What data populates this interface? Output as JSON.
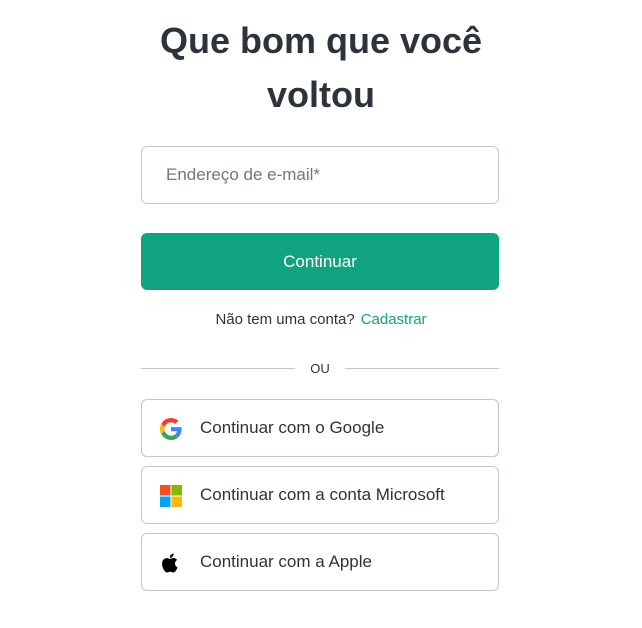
{
  "login": {
    "title_line1": "Que bom que você",
    "title_line2": "voltou",
    "email_placeholder": "Endereço de e-mail*",
    "email_value": "",
    "continue_label": "Continuar",
    "signup_prompt": "Não tem uma conta?",
    "signup_link": "Cadastrar",
    "divider_text": "OU",
    "providers": [
      {
        "label": "Continuar com o Google",
        "icon": "google-icon"
      },
      {
        "label": "Continuar com a conta Microsoft",
        "icon": "microsoft-icon"
      },
      {
        "label": "Continuar com a Apple",
        "icon": "apple-icon"
      }
    ]
  },
  "colors": {
    "accent": "#10a37f",
    "text": "#2d333a",
    "border": "#c2c8d0",
    "placeholder": "#6f7780"
  }
}
